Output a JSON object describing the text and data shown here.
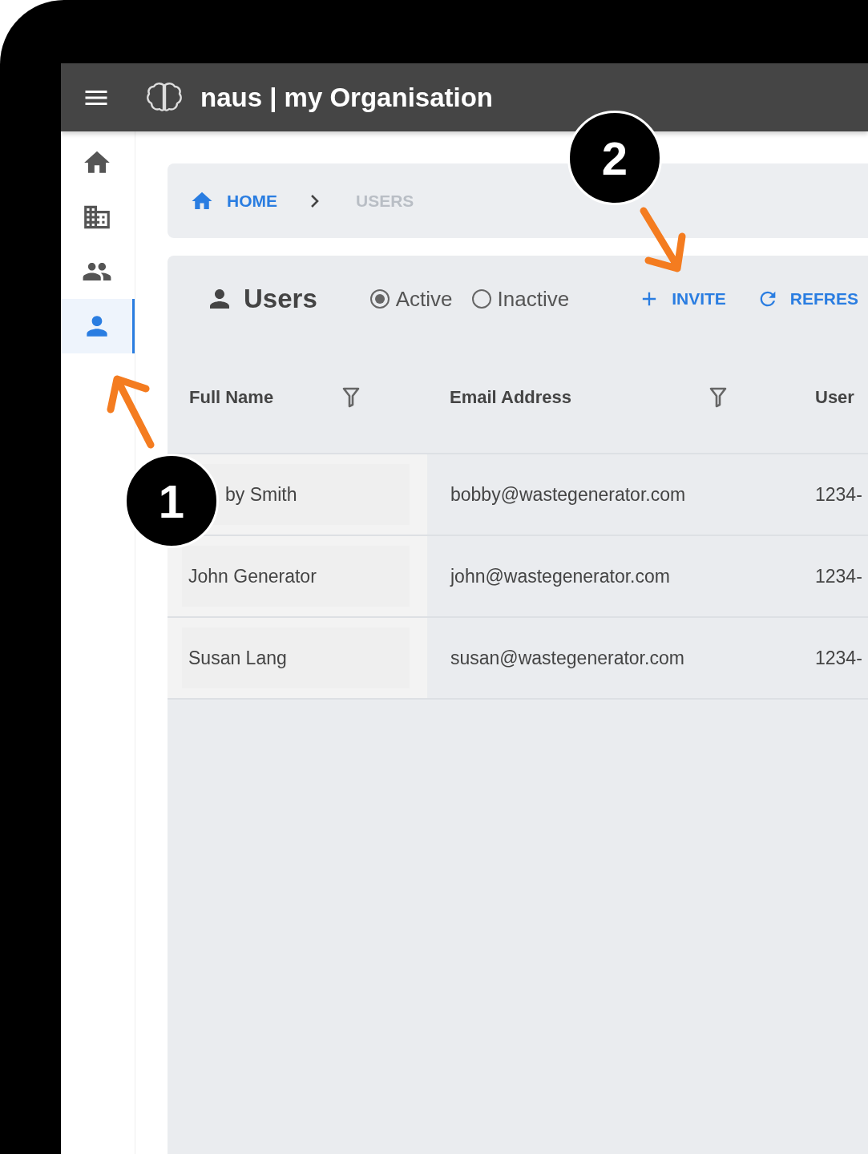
{
  "app_bar": {
    "title": "naus | my Organisation"
  },
  "sidebar": {
    "items": [
      {
        "kind": "home",
        "selected": false
      },
      {
        "kind": "building",
        "selected": false
      },
      {
        "kind": "group",
        "selected": false
      },
      {
        "kind": "person",
        "selected": true
      }
    ]
  },
  "breadcrumb": [
    {
      "label": "HOME",
      "kind": "link"
    },
    {
      "label": "USERS",
      "kind": "current"
    }
  ],
  "users_panel": {
    "title": "Users",
    "filters": [
      {
        "label": "Active",
        "selected": true
      },
      {
        "label": "Inactive",
        "selected": false
      }
    ],
    "actions": [
      {
        "label": "INVITE",
        "kind": "invite"
      },
      {
        "label": "REFRES",
        "kind": "refresh"
      }
    ]
  },
  "table": {
    "columns": [
      {
        "label": "Full Name",
        "filter": true
      },
      {
        "label": "Email Address",
        "filter": true
      },
      {
        "label": "User",
        "filter": false
      }
    ],
    "rows": [
      [
        "by Smith",
        "bobby@wastegenerator.com",
        "1234-"
      ],
      [
        "John Generator",
        "john@wastegenerator.com",
        "1234-"
      ],
      [
        "Susan Lang",
        "susan@wastegenerator.com",
        "1234-"
      ]
    ]
  },
  "annotations": [
    {
      "label": "1",
      "kind": "arrow-up-left"
    },
    {
      "label": "2",
      "kind": "arrow-down-right"
    }
  ]
}
